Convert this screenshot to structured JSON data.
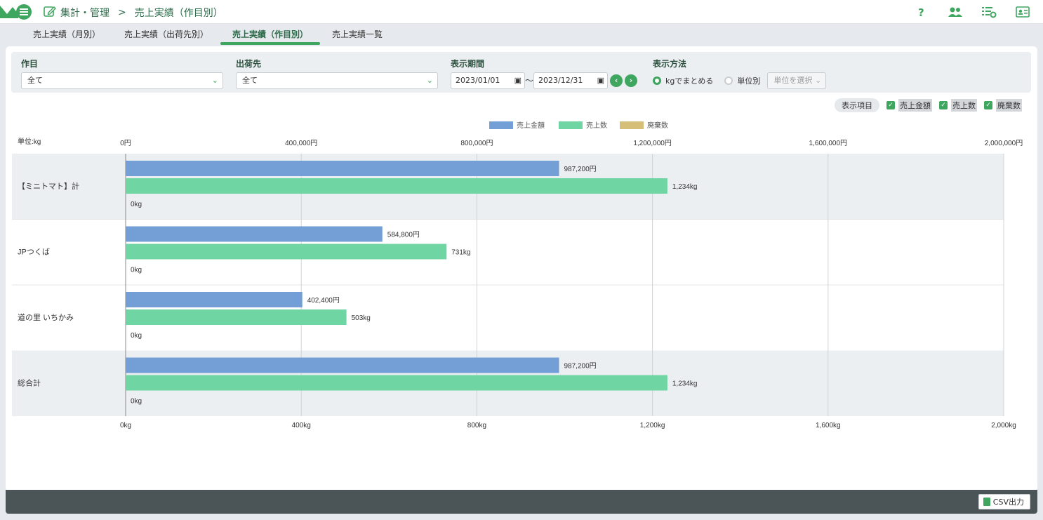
{
  "header": {
    "crumb_section": "集計・管理",
    "crumb_page": "売上実績（作目別）"
  },
  "tabs": [
    {
      "label": "売上実績（月別）"
    },
    {
      "label": "売上実績（出荷先別）"
    },
    {
      "label": "売上実績（作目別）",
      "active": true
    },
    {
      "label": "売上実績一覧"
    }
  ],
  "filters": {
    "crop": {
      "label": "作目",
      "value": "全て"
    },
    "destination": {
      "label": "出荷先",
      "value": "全て"
    },
    "period": {
      "label": "表示期間",
      "start": "2023/01/01",
      "sep": "～",
      "end": "2023/12/31"
    },
    "method": {
      "label": "表示方法",
      "opt_kg": "kgでまとめる",
      "opt_unit": "単位別",
      "unit_placeholder": "単位を選択",
      "selected": "kg"
    }
  },
  "display_items": {
    "label": "表示項目",
    "items": [
      {
        "label": "売上金額",
        "checked": true
      },
      {
        "label": "売上数",
        "checked": true
      },
      {
        "label": "廃棄数",
        "checked": true
      }
    ]
  },
  "colors": {
    "amount": "#739fd6",
    "qty": "#6fd6a3",
    "waste": "#d4be78",
    "accent": "#3ea65e"
  },
  "chart_data": {
    "type": "bar",
    "orientation": "horizontal",
    "unit_label": "単位:kg",
    "categories": [
      "【ミニトマト】計",
      "JPつくば",
      "道の里 いちかみ",
      "総合計"
    ],
    "series": [
      {
        "name": "売上金額",
        "values": [
          987200,
          584800,
          402400,
          987200
        ],
        "labels": [
          "987,200円",
          "584,800円",
          "402,400円",
          "987,200円"
        ],
        "axis": "top"
      },
      {
        "name": "売上数",
        "values": [
          1234,
          731,
          503,
          1234
        ],
        "labels": [
          "1,234kg",
          "731kg",
          "503kg",
          "1,234kg"
        ],
        "axis": "bottom"
      },
      {
        "name": "廃棄数",
        "values": [
          0,
          0,
          0,
          0
        ],
        "labels": [
          "0kg",
          "0kg",
          "0kg",
          "0kg"
        ],
        "axis": "bottom"
      }
    ],
    "top_axis": {
      "range": [
        0,
        2000000
      ],
      "ticks": [
        "0円",
        "400,000円",
        "800,000円",
        "1,200,000円",
        "1,600,000円",
        "2,000,000円"
      ]
    },
    "bottom_axis": {
      "range": [
        0,
        2000
      ],
      "ticks": [
        "0kg",
        "400kg",
        "800kg",
        "1,200kg",
        "1,600kg",
        "2,000kg"
      ]
    },
    "legend": "top-center",
    "grid": true
  },
  "footer": {
    "csv_label": "CSV出力"
  }
}
